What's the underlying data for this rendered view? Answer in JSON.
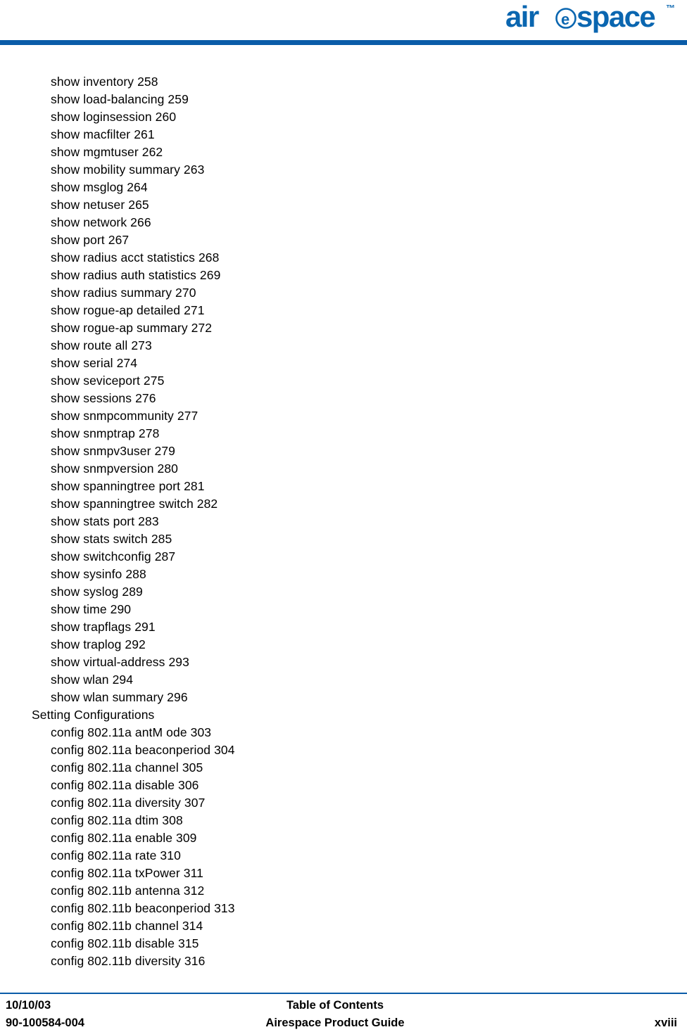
{
  "header": {
    "logo_text": "airespace",
    "logo_trademark": "™",
    "logo_color": "#0a66b0",
    "rule_color": "#0a5ca8"
  },
  "toc": {
    "lines": [
      {
        "text": "show inventory 258",
        "level": "entry"
      },
      {
        "text": "show load-balancing 259",
        "level": "entry"
      },
      {
        "text": "show loginsession 260",
        "level": "entry"
      },
      {
        "text": "show macfilter 261",
        "level": "entry"
      },
      {
        "text": "show mgmtuser 262",
        "level": "entry"
      },
      {
        "text": "show mobility summary 263",
        "level": "entry"
      },
      {
        "text": "show msglog 264",
        "level": "entry"
      },
      {
        "text": "show netuser 265",
        "level": "entry"
      },
      {
        "text": "show network 266",
        "level": "entry"
      },
      {
        "text": "show port 267",
        "level": "entry"
      },
      {
        "text": "show radius acct statistics 268",
        "level": "entry"
      },
      {
        "text": "show radius auth statistics 269",
        "level": "entry"
      },
      {
        "text": "show radius summary 270",
        "level": "entry"
      },
      {
        "text": "show rogue-ap detailed 271",
        "level": "entry"
      },
      {
        "text": "show rogue-ap summary 272",
        "level": "entry"
      },
      {
        "text": "show route all 273",
        "level": "entry"
      },
      {
        "text": "show serial 274",
        "level": "entry"
      },
      {
        "text": "show seviceport 275",
        "level": "entry"
      },
      {
        "text": "show sessions 276",
        "level": "entry"
      },
      {
        "text": "show snmpcommunity 277",
        "level": "entry"
      },
      {
        "text": "show snmptrap 278",
        "level": "entry"
      },
      {
        "text": "show snmpv3user 279",
        "level": "entry"
      },
      {
        "text": "show snmpversion 280",
        "level": "entry"
      },
      {
        "text": "show spanningtree port 281",
        "level": "entry"
      },
      {
        "text": "show spanningtree switch 282",
        "level": "entry"
      },
      {
        "text": "show stats port 283",
        "level": "entry"
      },
      {
        "text": "show stats switch 285",
        "level": "entry"
      },
      {
        "text": "show switchconfig 287",
        "level": "entry"
      },
      {
        "text": "show sysinfo 288",
        "level": "entry"
      },
      {
        "text": "show syslog 289",
        "level": "entry"
      },
      {
        "text": "show time 290",
        "level": "entry"
      },
      {
        "text": "show trapflags 291",
        "level": "entry"
      },
      {
        "text": "show traplog 292",
        "level": "entry"
      },
      {
        "text": "show virtual-address 293",
        "level": "entry"
      },
      {
        "text": "show wlan 294",
        "level": "entry"
      },
      {
        "text": "show wlan summary 296",
        "level": "entry"
      },
      {
        "text": "Setting Configurations",
        "level": "heading"
      },
      {
        "text": "config 802.11a antM ode 303",
        "level": "entry"
      },
      {
        "text": "config 802.11a beaconperiod 304",
        "level": "entry"
      },
      {
        "text": "config 802.11a channel 305",
        "level": "entry"
      },
      {
        "text": "config 802.11a disable 306",
        "level": "entry"
      },
      {
        "text": "config 802.11a diversity 307",
        "level": "entry"
      },
      {
        "text": "config 802.11a dtim 308",
        "level": "entry"
      },
      {
        "text": "config 802.11a enable 309",
        "level": "entry"
      },
      {
        "text": "config 802.11a rate 310",
        "level": "entry"
      },
      {
        "text": "config 802.11a txPower 311",
        "level": "entry"
      },
      {
        "text": "config 802.11b antenna 312",
        "level": "entry"
      },
      {
        "text": "config 802.11b beaconperiod 313",
        "level": "entry"
      },
      {
        "text": "config 802.11b channel 314",
        "level": "entry"
      },
      {
        "text": "config 802.11b disable 315",
        "level": "entry"
      },
      {
        "text": "config 802.11b diversity 316",
        "level": "entry"
      }
    ]
  },
  "footer": {
    "date": "10/10/03",
    "part_number": "90-100584-004",
    "title": "Table of Contents",
    "document": "Airespace Product Guide",
    "page_number": "xviii",
    "rule_color": "#0a5ca8"
  }
}
